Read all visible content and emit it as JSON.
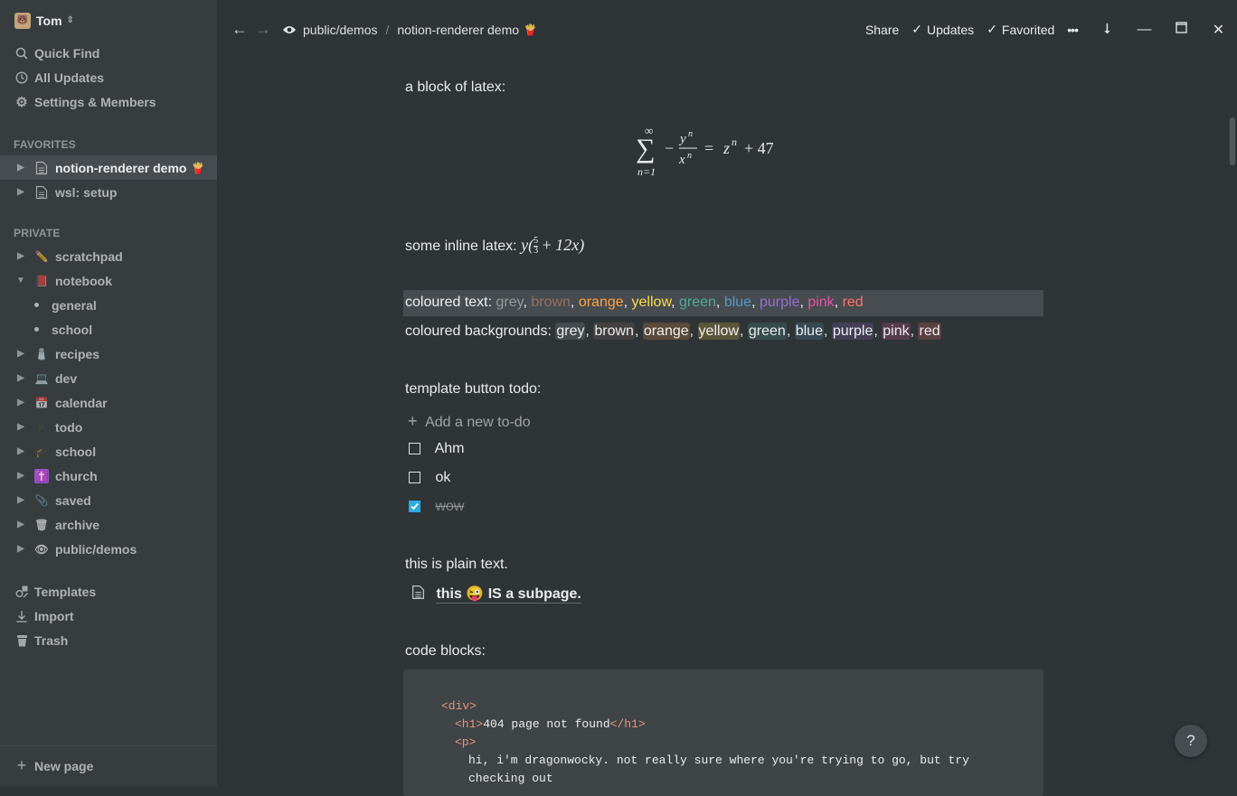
{
  "workspace": {
    "name": "Tom",
    "switcher": "⇕"
  },
  "sidebar": {
    "top_items": [
      {
        "label": "Quick Find",
        "icon": "search-icon"
      },
      {
        "label": "All Updates",
        "icon": "clock-icon"
      },
      {
        "label": "Settings & Members",
        "icon": "gear-icon"
      }
    ],
    "favorites_header": "FAVORITES",
    "favorites": [
      {
        "label": "notion-renderer demo",
        "emoji": "🍟",
        "active": true
      },
      {
        "label": "wsl: setup",
        "emoji": ""
      }
    ],
    "private_header": "PRIVATE",
    "private": [
      {
        "label": "scratchpad",
        "emoji": "✏️"
      },
      {
        "label": "notebook",
        "emoji": "📕",
        "expanded": true
      },
      {
        "label": "general",
        "child": true
      },
      {
        "label": "school",
        "child": true
      },
      {
        "label": "recipes",
        "emoji": "🧂"
      },
      {
        "label": "dev",
        "emoji": "💻"
      },
      {
        "label": "calendar",
        "emoji": "📅"
      },
      {
        "label": "todo",
        "emoji": "✔"
      },
      {
        "label": "school",
        "emoji": "🎓"
      },
      {
        "label": "church",
        "emoji": "✝️"
      },
      {
        "label": "saved",
        "emoji": "📎"
      },
      {
        "label": "archive",
        "emoji": "🗑"
      },
      {
        "label": "public/demos",
        "emoji": "👁"
      }
    ],
    "bottom_items": [
      {
        "label": "Templates",
        "icon": "shapes-icon"
      },
      {
        "label": "Import",
        "icon": "download-icon"
      },
      {
        "label": "Trash",
        "icon": "trash-icon"
      }
    ],
    "new_page": "New page"
  },
  "topbar": {
    "crumb_parent": "public/demos",
    "crumb_sep": "/",
    "crumb_current": "notion-renderer demo",
    "crumb_emoji": "🍟",
    "share": "Share",
    "updates": "Updates",
    "favorited": "Favorited",
    "more": "•••"
  },
  "page": {
    "latex_block_label": "a block of latex:",
    "latex_block_formula": "∑ₙ₌₁^∞ −yⁿ/xⁿ = zⁿ + 47",
    "latex_inline_label": "some inline latex:",
    "latex_inline_formula": "y(5/3 + 12x)",
    "coloured_text_label": "coloured text:",
    "coloured_text": [
      {
        "text": "grey",
        "color": "#979a9b"
      },
      {
        "text": "brown",
        "color": "#937264"
      },
      {
        "text": "orange",
        "color": "#ffa344"
      },
      {
        "text": "yellow",
        "color": "#ffdc49"
      },
      {
        "text": "green",
        "color": "#4dab9a"
      },
      {
        "text": "blue",
        "color": "#529cca"
      },
      {
        "text": "purple",
        "color": "#9a6dd7"
      },
      {
        "text": "pink",
        "color": "#e255a1"
      },
      {
        "text": "red",
        "color": "#ff7369"
      }
    ],
    "coloured_bg_label": "coloured backgrounds:",
    "coloured_bgs": [
      {
        "text": "grey",
        "color": "#454b4e"
      },
      {
        "text": "brown",
        "color": "#434040"
      },
      {
        "text": "orange",
        "color": "#594a3a"
      },
      {
        "text": "yellow",
        "color": "#59563b"
      },
      {
        "text": "green",
        "color": "#354c4b"
      },
      {
        "text": "blue",
        "color": "#364954"
      },
      {
        "text": "purple",
        "color": "#443f57"
      },
      {
        "text": "pink",
        "color": "#533b4c"
      },
      {
        "text": "red",
        "color": "#594141"
      }
    ],
    "template_label": "template button todo:",
    "add_todo": "Add a new to-do",
    "todos": [
      {
        "text": "Ahm",
        "done": false
      },
      {
        "text": "ok",
        "done": false
      },
      {
        "text": "wow",
        "done": true
      }
    ],
    "plain_text": "this is plain text.",
    "subpage_a": "this",
    "subpage_emoji": "😜",
    "subpage_b": "IS a subpage.",
    "code_label": "code blocks:",
    "code_lines": [
      {
        "open": "<div>",
        "text": "",
        "close": ""
      },
      {
        "open": "<h1>",
        "text": "404 page not found",
        "close": "</h1>"
      },
      {
        "open": "<p>",
        "text": "",
        "close": ""
      },
      {
        "open": "",
        "text": "hi, i'm dragonwocky. not really sure where you're trying to go, but try",
        "close": ""
      },
      {
        "open": "",
        "text": "checking out",
        "close": ""
      }
    ],
    "help": "?"
  }
}
